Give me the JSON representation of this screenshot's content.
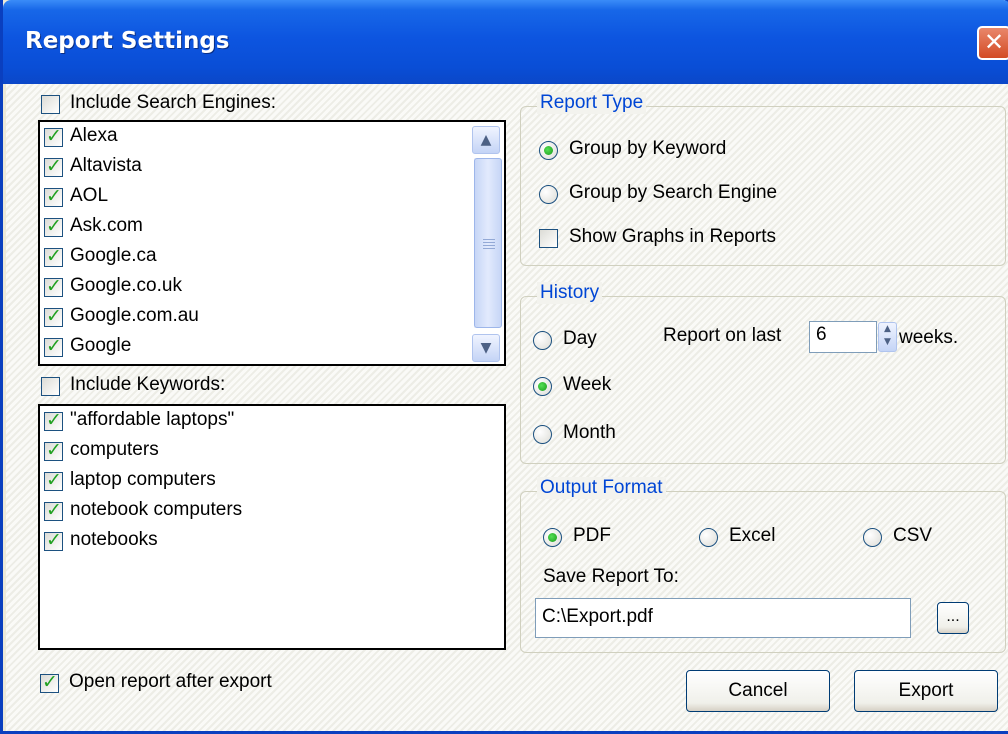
{
  "window": {
    "title": "Report Settings",
    "close_glyph": "✕"
  },
  "search_engines": {
    "label": "Include Search Engines:",
    "checked": false,
    "items": [
      "Alexa",
      "Altavista",
      "AOL",
      "Ask.com",
      "Google.ca",
      "Google.co.uk",
      "Google.com.au",
      "Google"
    ]
  },
  "keywords": {
    "label": "Include Keywords:",
    "checked": false,
    "items": [
      "\"affordable laptops\"",
      "computers",
      "laptop computers",
      "notebook computers",
      "notebooks"
    ]
  },
  "report_type": {
    "title": "Report Type",
    "group_by_keyword": "Group by Keyword",
    "group_by_engine": "Group by Search Engine",
    "selected": "group_by_keyword",
    "show_graphs": "Show Graphs in Reports",
    "show_graphs_checked": false
  },
  "history": {
    "title": "History",
    "day": "Day",
    "week": "Week",
    "month": "Month",
    "selected": "week",
    "report_on_last": "Report on last",
    "value": "6",
    "unit": "weeks."
  },
  "output_format": {
    "title": "Output Format",
    "pdf": "PDF",
    "excel": "Excel",
    "csv": "CSV",
    "selected": "pdf",
    "save_label": "Save Report To:",
    "path": "C:\\Export.pdf",
    "browse": "..."
  },
  "open_after_export": {
    "label": "Open report after export",
    "checked": true
  },
  "buttons": {
    "cancel": "Cancel",
    "export": "Export"
  },
  "colors": {
    "titlebar": "#0a4ed6",
    "group_title": "#0046d5",
    "check": "#21a121"
  }
}
